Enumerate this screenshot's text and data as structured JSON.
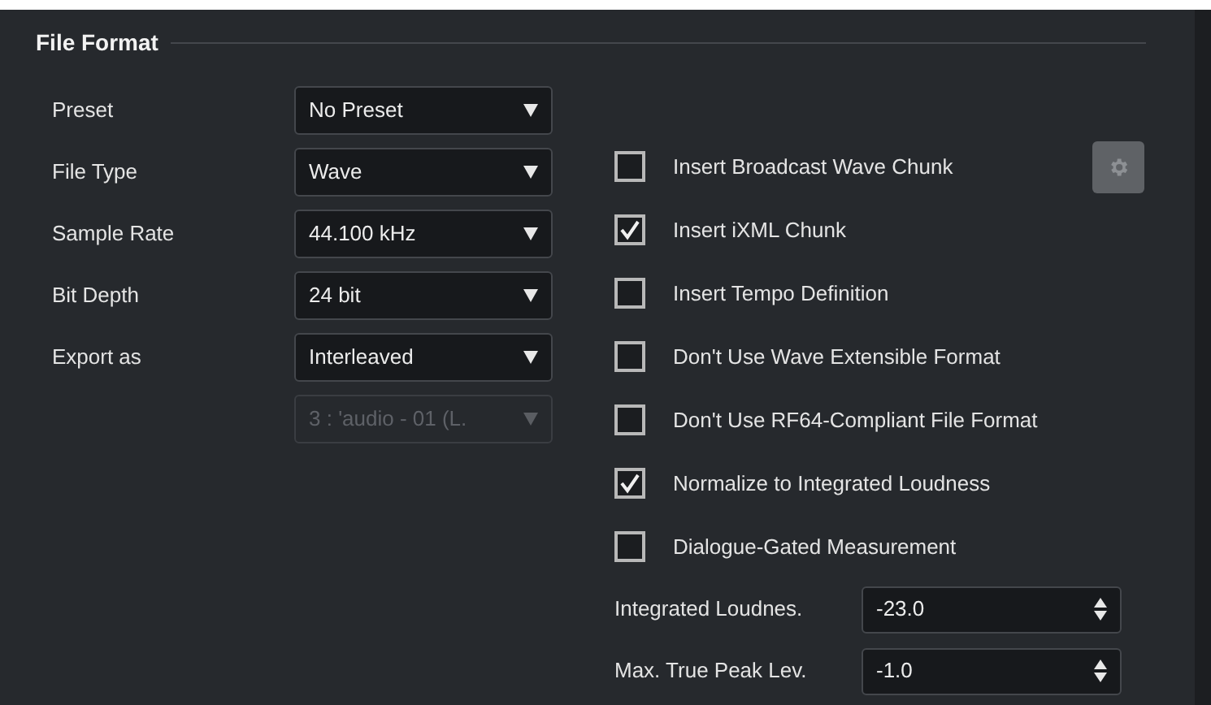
{
  "section": {
    "title": "File Format"
  },
  "dropdowns": [
    {
      "label": "Preset",
      "value": "No Preset",
      "disabled": false
    },
    {
      "label": "File Type",
      "value": "Wave",
      "disabled": false
    },
    {
      "label": "Sample Rate",
      "value": "44.100 kHz",
      "disabled": false
    },
    {
      "label": "Bit Depth",
      "value": "24 bit",
      "disabled": false
    },
    {
      "label": "Export as",
      "value": "Interleaved",
      "disabled": false
    },
    {
      "value": "3 : 'audio - 01 (L.",
      "disabled": true
    }
  ],
  "options": [
    {
      "label": "Insert Broadcast Wave Chunk",
      "checked": false,
      "has_settings": true
    },
    {
      "label": "Insert iXML Chunk",
      "checked": true,
      "has_settings": false
    },
    {
      "label": "Insert Tempo Definition",
      "checked": false,
      "has_settings": false
    },
    {
      "label": "Don't Use Wave Extensible Format",
      "checked": false,
      "has_settings": false
    },
    {
      "label": "Don't Use RF64-Compliant File Format",
      "checked": false,
      "has_settings": false
    },
    {
      "label": "Normalize to Integrated Loudness",
      "checked": true,
      "has_settings": false
    },
    {
      "label": "Dialogue-Gated Measurement",
      "checked": false,
      "has_settings": false
    }
  ],
  "number_fields": [
    {
      "label": "Integrated Loudnes.",
      "value": "-23.0"
    },
    {
      "label": "Max. True Peak Lev.",
      "value": "-1.0"
    }
  ]
}
